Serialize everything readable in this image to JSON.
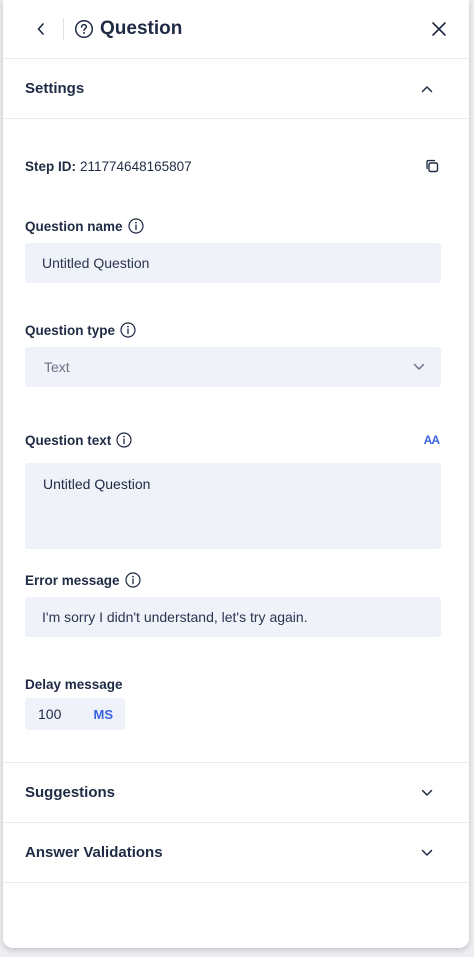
{
  "header": {
    "title": "Question",
    "back_icon": "chevron-left-icon",
    "help_icon": "help-circle-icon",
    "close_icon": "close-icon"
  },
  "sections": {
    "settings": {
      "title": "Settings",
      "state": "expanded"
    },
    "suggestions": {
      "title": "Suggestions",
      "state": "collapsed"
    },
    "answer_validations": {
      "title": "Answer Validations",
      "state": "collapsed"
    }
  },
  "settings": {
    "step_id_label": "Step ID:",
    "step_id_value": "211774648165807",
    "question_name": {
      "label": "Question name",
      "value": "Untitled Question"
    },
    "question_type": {
      "label": "Question type",
      "value": "Text"
    },
    "question_text": {
      "label": "Question text",
      "value": "Untitled Question",
      "font_button": "AA"
    },
    "error_message": {
      "label": "Error message",
      "value": "I'm sorry I didn't understand, let's try again."
    },
    "delay_message": {
      "label": "Delay message",
      "value": "100",
      "unit": "MS"
    }
  },
  "colors": {
    "accent": "#3b63e0",
    "text": "#1f2a44",
    "field_bg": "#eff2f8",
    "border": "#e9ebef"
  }
}
